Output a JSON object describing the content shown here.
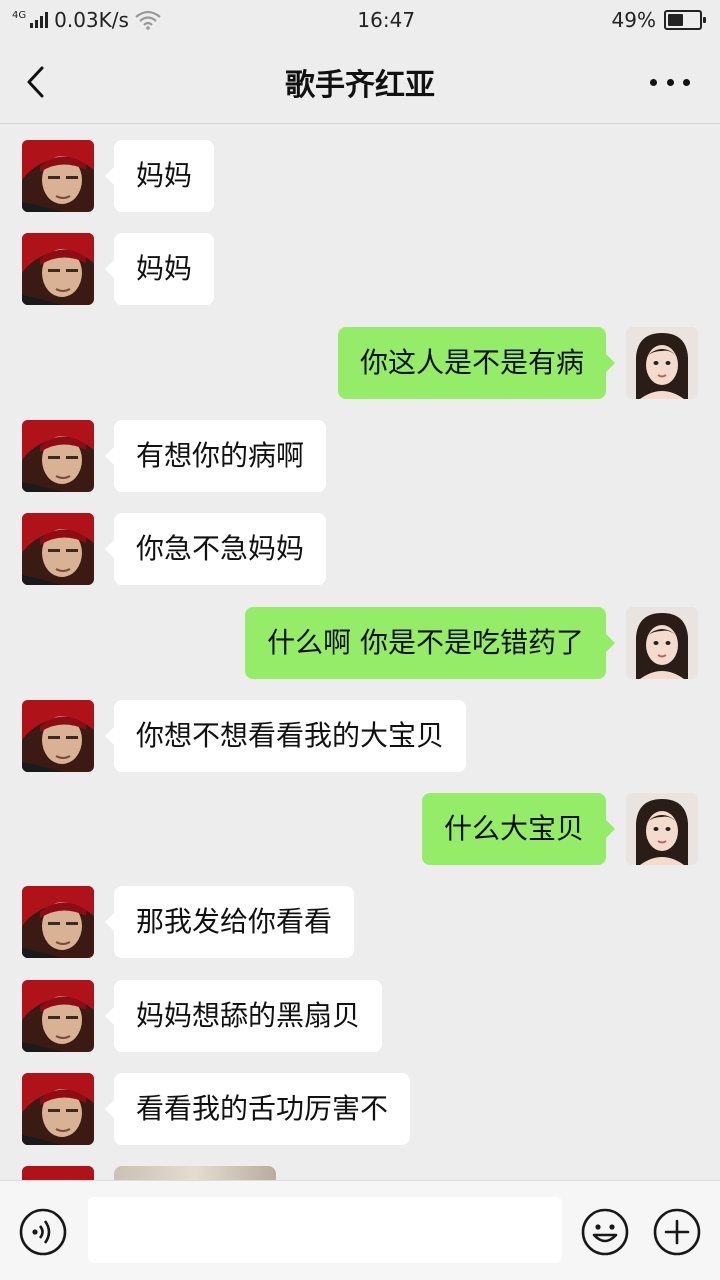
{
  "status_bar": {
    "network_type": "4G",
    "speed": "0.03K/s",
    "time": "16:47",
    "battery": "49%",
    "battery_level": 0.49,
    "icons": [
      "signal-icon",
      "wifi-icon",
      "battery-icon"
    ]
  },
  "header": {
    "title": "歌手齐红亚",
    "icons": [
      "back-icon",
      "more-icon"
    ]
  },
  "messages": [
    {
      "side": "left",
      "text": "妈妈"
    },
    {
      "side": "left",
      "text": "妈妈"
    },
    {
      "side": "right",
      "text": "你这人是不是有病"
    },
    {
      "side": "left",
      "text": "有想你的病啊"
    },
    {
      "side": "left",
      "text": "你急不急妈妈"
    },
    {
      "side": "right",
      "text": "什么啊  你是不是吃错药了"
    },
    {
      "side": "left",
      "text": "你想不想看看我的大宝贝"
    },
    {
      "side": "right",
      "text": "什么大宝贝"
    },
    {
      "side": "left",
      "text": "那我发给你看看"
    },
    {
      "side": "left",
      "text": "妈妈想舔的黑扇贝"
    },
    {
      "side": "left",
      "text": "看看我的舌功厉害不"
    },
    {
      "side": "left",
      "type": "image"
    }
  ],
  "input_bar": {
    "value": "",
    "icons": [
      "voice-icon",
      "emoji-icon",
      "plus-icon"
    ]
  },
  "colors": {
    "background": "#ededed",
    "sent_bubble": "#95ec69",
    "received_bubble": "#ffffff"
  }
}
